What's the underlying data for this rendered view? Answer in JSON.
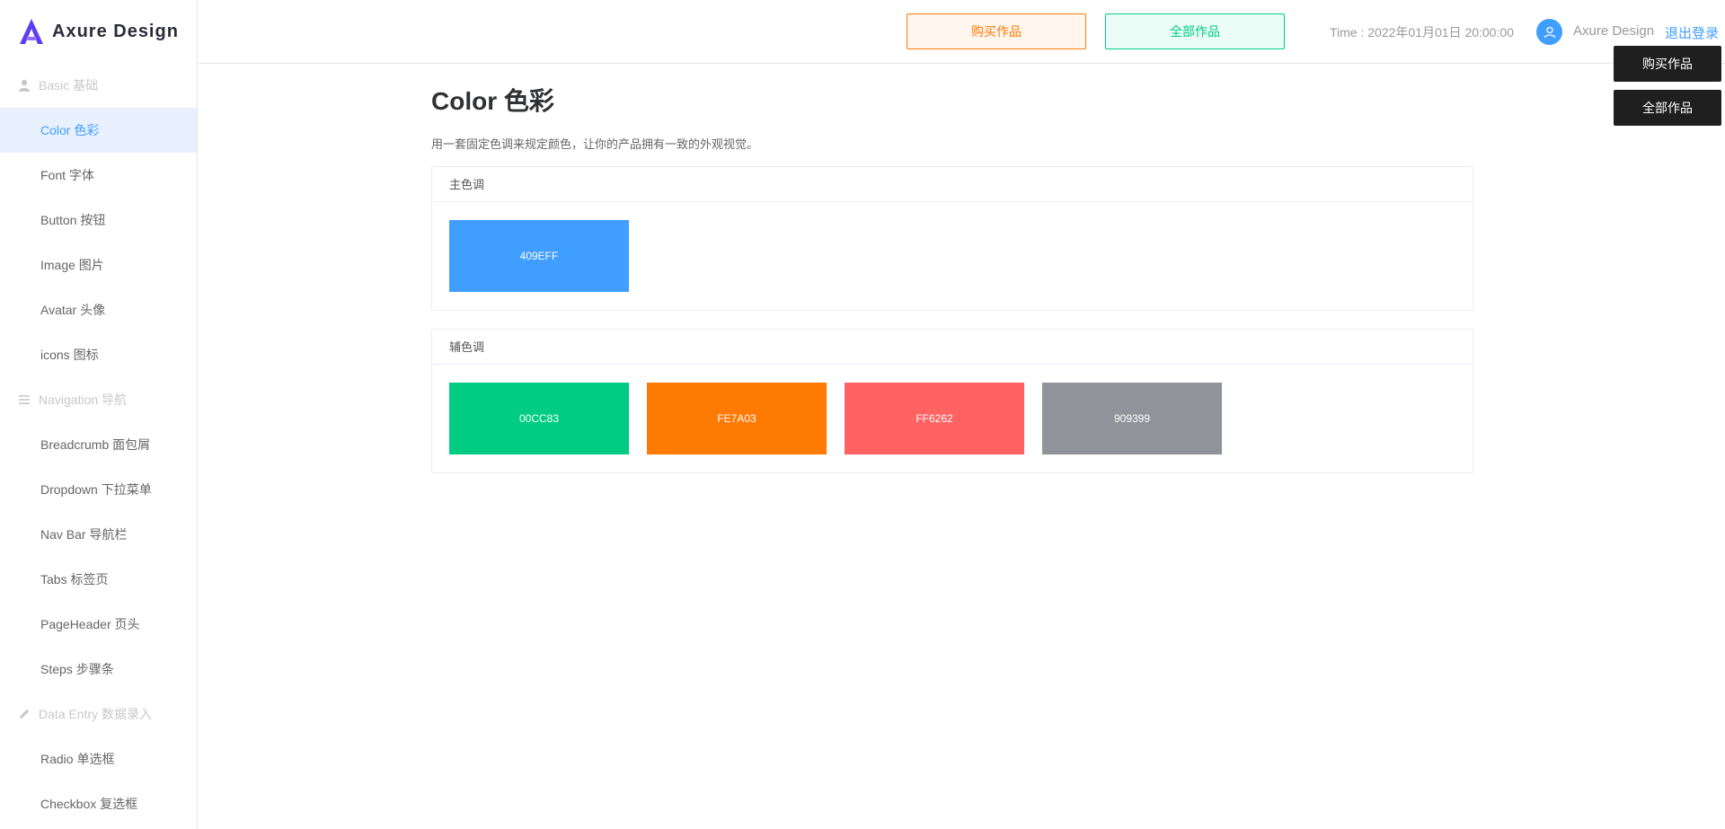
{
  "logo": {
    "text": "Axure Design",
    "color": "#5b3df5"
  },
  "sidebar": {
    "groups": [
      {
        "label": "Basic 基础",
        "icon": "user-icon",
        "items": [
          {
            "label": "Color 色彩",
            "active": true
          },
          {
            "label": "Font 字体"
          },
          {
            "label": "Button 按钮"
          },
          {
            "label": "Image 图片"
          },
          {
            "label": "Avatar 头像"
          },
          {
            "label": "icons 图标"
          }
        ]
      },
      {
        "label": "Navigation 导航",
        "icon": "menu-icon",
        "items": [
          {
            "label": "Breadcrumb 面包屑"
          },
          {
            "label": "Dropdown 下拉菜单"
          },
          {
            "label": "Nav Bar 导航栏"
          },
          {
            "label": "Tabs 标签页"
          },
          {
            "label": "PageHeader 页头"
          },
          {
            "label": "Steps 步骤条"
          }
        ]
      },
      {
        "label": "Data Entry 数据录入",
        "icon": "pencil-icon",
        "items": [
          {
            "label": "Radio 单选框"
          },
          {
            "label": "Checkbox 复选框"
          }
        ]
      }
    ]
  },
  "header": {
    "buy_label": "购买作品",
    "all_label": "全部作品",
    "time": "Time : 2022年01月01日   20:00:00",
    "user_name": "Axure Design",
    "logout_label": "退出登录"
  },
  "floating": {
    "buy_label": "购买作品",
    "all_label": "全部作品"
  },
  "main": {
    "title": "Color 色彩",
    "description": "用一套固定色调来规定颜色，让你的产品拥有一致的外观视觉。",
    "primary": {
      "title": "主色调",
      "colors": [
        {
          "label": "409EFF",
          "hex": "#409EFF"
        }
      ]
    },
    "secondary": {
      "title": "辅色调",
      "colors": [
        {
          "label": "00CC83",
          "hex": "#00CC83"
        },
        {
          "label": "FE7A03",
          "hex": "#FE7A03"
        },
        {
          "label": "FF6262",
          "hex": "#FF6262"
        },
        {
          "label": "909399",
          "hex": "#909399"
        }
      ]
    }
  }
}
